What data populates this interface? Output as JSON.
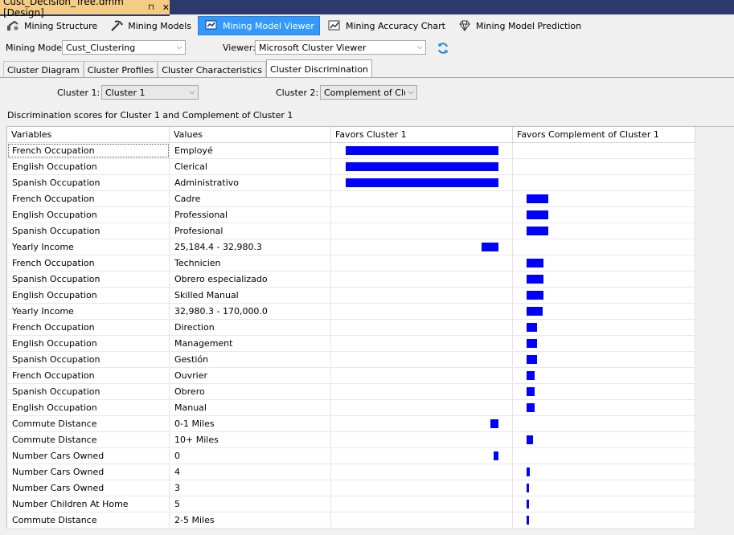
{
  "document_tab": {
    "title": "Cust_Decision_Tree.dmm [Design]",
    "pin_glyph": "⊓",
    "close_glyph": "✕"
  },
  "toolbar": {
    "items": [
      {
        "label": "Mining Structure",
        "icon": "mining-structure-icon"
      },
      {
        "label": "Mining Models",
        "icon": "pickaxe-icon"
      },
      {
        "label": "Mining Model Viewer",
        "icon": "model-viewer-icon"
      },
      {
        "label": "Mining Accuracy Chart",
        "icon": "accuracy-chart-icon"
      },
      {
        "label": "Mining Model Prediction",
        "icon": "diamond-icon"
      }
    ],
    "active_index": 2
  },
  "model_bar": {
    "mining_model_label": "Mining Model:",
    "mining_model_value": "Cust_Clustering",
    "viewer_label": "Viewer:",
    "viewer_value": "Microsoft Cluster Viewer"
  },
  "view_tabs": [
    "Cluster Diagram",
    "Cluster Profiles",
    "Cluster Characteristics",
    "Cluster Discrimination"
  ],
  "active_view_tab": 3,
  "cluster_select": {
    "cluster1_label": "Cluster 1:",
    "cluster1_value": "Cluster 1",
    "cluster2_label": "Cluster 2:",
    "cluster2_value": "Complement of Clust"
  },
  "caption": "Discrimination scores for Cluster 1 and Complement of Cluster 1",
  "grid": {
    "headers": [
      "Variables",
      "Values",
      "Favors Cluster 1",
      "Favors Complement of Cluster 1"
    ],
    "max_score": 100,
    "rows": [
      {
        "variable": "French Occupation",
        "value": "Employé",
        "favors": "cluster1",
        "score": 100
      },
      {
        "variable": "English Occupation",
        "value": "Clerical",
        "favors": "cluster1",
        "score": 100
      },
      {
        "variable": "Spanish Occupation",
        "value": "Administrativo",
        "favors": "cluster1",
        "score": 100
      },
      {
        "variable": "French Occupation",
        "value": "Cadre",
        "favors": "complement",
        "score": 14
      },
      {
        "variable": "English Occupation",
        "value": "Professional",
        "favors": "complement",
        "score": 14
      },
      {
        "variable": "Spanish Occupation",
        "value": "Profesional",
        "favors": "complement",
        "score": 14
      },
      {
        "variable": "Yearly Income",
        "value": "25,184.4 - 32,980.3",
        "favors": "cluster1",
        "score": 11
      },
      {
        "variable": "French Occupation",
        "value": "Technicien",
        "favors": "complement",
        "score": 11
      },
      {
        "variable": "Spanish Occupation",
        "value": "Obrero especializado",
        "favors": "complement",
        "score": 11
      },
      {
        "variable": "English Occupation",
        "value": "Skilled Manual",
        "favors": "complement",
        "score": 11
      },
      {
        "variable": "Yearly Income",
        "value": "32,980.3 - 170,000.0",
        "favors": "complement",
        "score": 10.5
      },
      {
        "variable": "French Occupation",
        "value": "Direction",
        "favors": "complement",
        "score": 7
      },
      {
        "variable": "English Occupation",
        "value": "Management",
        "favors": "complement",
        "score": 7
      },
      {
        "variable": "Spanish Occupation",
        "value": "Gestión",
        "favors": "complement",
        "score": 7
      },
      {
        "variable": "French Occupation",
        "value": "Ouvrier",
        "favors": "complement",
        "score": 5
      },
      {
        "variable": "Spanish Occupation",
        "value": "Obrero",
        "favors": "complement",
        "score": 5
      },
      {
        "variable": "English Occupation",
        "value": "Manual",
        "favors": "complement",
        "score": 5
      },
      {
        "variable": "Commute Distance",
        "value": "0-1 Miles",
        "favors": "cluster1",
        "score": 5
      },
      {
        "variable": "Commute Distance",
        "value": "10+ Miles",
        "favors": "complement",
        "score": 4
      },
      {
        "variable": "Number Cars Owned",
        "value": "0",
        "favors": "cluster1",
        "score": 3
      },
      {
        "variable": "Number Cars Owned",
        "value": "4",
        "favors": "complement",
        "score": 2
      },
      {
        "variable": "Number Cars Owned",
        "value": "3",
        "favors": "complement",
        "score": 1.5
      },
      {
        "variable": "Number Children At Home",
        "value": "5",
        "favors": "complement",
        "score": 1
      },
      {
        "variable": "Commute Distance",
        "value": "2-5 Miles",
        "favors": "complement",
        "score": 1
      }
    ]
  },
  "colors": {
    "bar": "#0000ff",
    "active_toolbar": "#3399ff",
    "doc_tab": "#f5cc84"
  }
}
